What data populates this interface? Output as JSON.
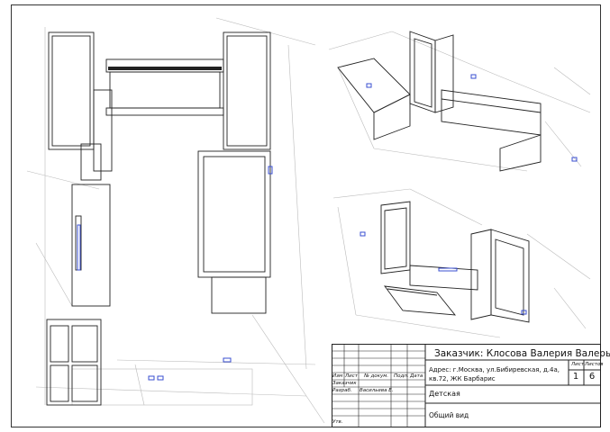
{
  "title_block": {
    "client": "Заказчик: Клосова Валерия Валерьевна",
    "address": "Адрес: г.Москва, ул.Бибиревская, д.4а, кв.72, ЖК Барбарис",
    "room": "Детская",
    "view_name": "Общий вид",
    "header_cells": {
      "izm": "Изм",
      "list": "Лист",
      "doc_no": "№ докум.",
      "sign": "Подп.",
      "date": "Дата"
    },
    "rows": {
      "customer_label": "Заказчик",
      "developer_label": "Разраб.",
      "developer_name": "Васильева Е.",
      "approved_label": "Утв."
    },
    "sheet": {
      "sheet_label": "Лист",
      "sheets_label": "Листов",
      "sheet_value": "1",
      "sheets_value": "6"
    }
  }
}
